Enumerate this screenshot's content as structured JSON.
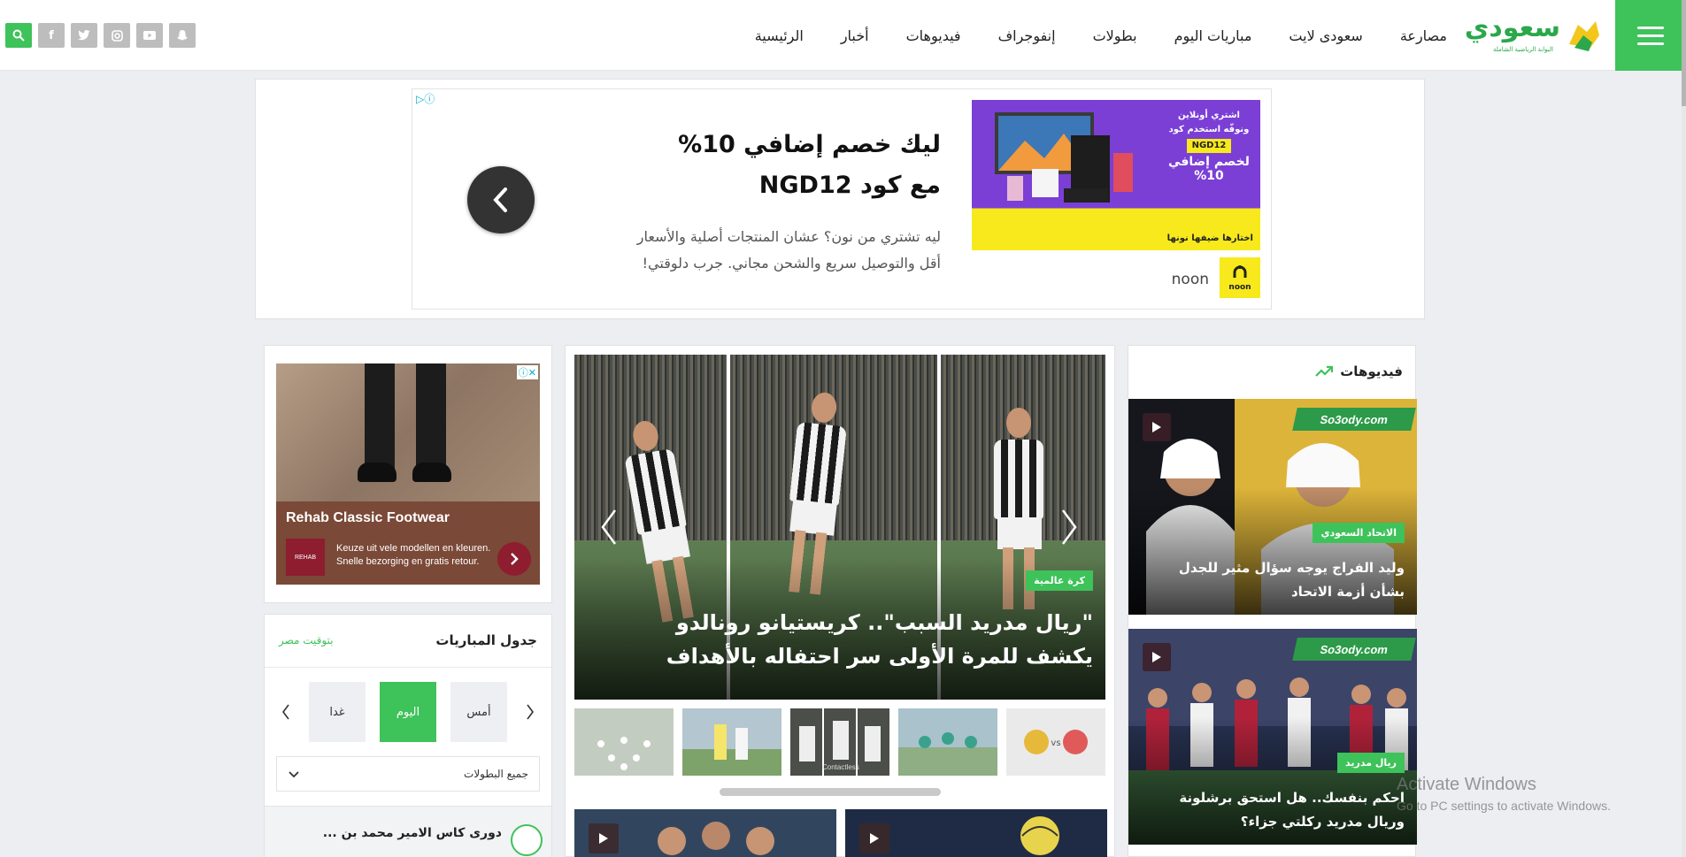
{
  "header": {
    "logo_text": "سعودي",
    "logo_sub": "البوابة الرياضية الشاملة",
    "nav": [
      "الرئيسية",
      "أخبار",
      "فيديوهات",
      "إنفوجراف",
      "بطولات",
      "مباريات اليوم",
      "سعودى لايت",
      "مصارعة"
    ],
    "social": [
      {
        "name": "search-icon",
        "glyph": "⚲"
      },
      {
        "name": "facebook-icon",
        "glyph": "f"
      },
      {
        "name": "twitter-icon",
        "glyph": "t"
      },
      {
        "name": "instagram-icon",
        "glyph": "◎"
      },
      {
        "name": "youtube-icon",
        "glyph": "▶"
      },
      {
        "name": "snapchat-icon",
        "glyph": "☺"
      }
    ]
  },
  "top_ad": {
    "title": "ليك خصم إضافي 10% مع كود NGD12",
    "description": "ليه تشتري من نون؟ عشان المنتجات أصلية والأسعار أقل والتوصيل سريع والشحن مجاني. جرب دلوقتي!",
    "image_line1": "اشتري أونلاين ونوفّه استخدم كود",
    "image_code": "NGD12",
    "image_line2": "لخصم إضافي 10%",
    "image_yellow": "اختارها ضيفها نونها",
    "brand_logo": "noon",
    "brand": "noon"
  },
  "left_ad": {
    "title": "Rehab Classic Footwear",
    "logo": "REHAB",
    "text": "Keuze uit vele modellen en kleuren. Snelle bezorging en gratis retour."
  },
  "matches": {
    "title": "جدول المباريات",
    "timezone": "بتوقيت مصر",
    "days": [
      "أمس",
      "اليوم",
      "غدا"
    ],
    "active_day": "اليوم",
    "league_filter": "جميع البطولات",
    "league_row": "دورى كاس الامير محمد بن ..."
  },
  "slider": {
    "tag": "كرة عالمية",
    "title": "\"ريال مدريد السبب\".. كريستيانو رونالدو يكشف للمرة الأولى سر احتفاله بالأهداف",
    "thumb_text": "Contactless"
  },
  "videos": {
    "heading": "فيديوهات",
    "watermark_brand": "So3ody.com",
    "items": [
      {
        "tag": "الاتحاد السعودي",
        "title": "وليد الفراج يوجه سؤال مثير للجدل بشأن أزمة الاتحاد"
      },
      {
        "tag": "ريال مدريد",
        "title": "احكم بنفسك.. هل استحق برشلونة وريال مدريد ركلتي جزاء؟"
      }
    ]
  },
  "os_watermark": {
    "line1": "Activate Windows",
    "line2": "Go to PC settings to activate Windows."
  },
  "colors": {
    "accent": "#3ec25a",
    "background": "#eceef1"
  }
}
